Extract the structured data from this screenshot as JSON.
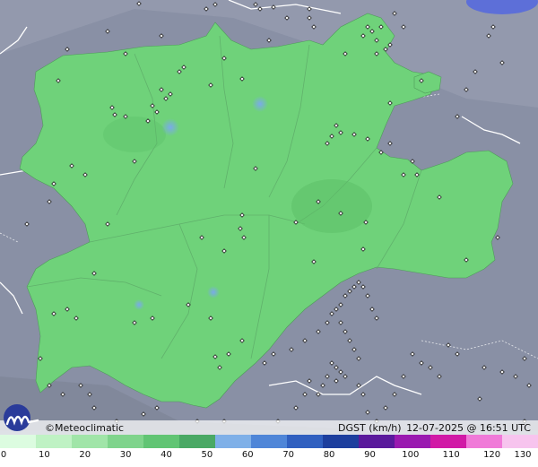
{
  "footer": {
    "brand": "Meteoclimatic",
    "copyright_symbol": "©",
    "variable": "DGST (km/h)",
    "timestamp": "12-07-2025 @ 16:51 UTC"
  },
  "legend": {
    "unit": "km/h",
    "ticks": [
      "0",
      "10",
      "20",
      "30",
      "40",
      "50",
      "60",
      "70",
      "80",
      "90",
      "100",
      "110",
      "120",
      "130"
    ],
    "colors": [
      "#dcfce0",
      "#bff2c4",
      "#a0e5a8",
      "#7fd48c",
      "#61c574",
      "#4aa965",
      "#7fb0e8",
      "#4f86d8",
      "#3060c0",
      "#1d3f9e",
      "#5a1a9c",
      "#9a1ab0",
      "#d11aa6",
      "#f07ad8",
      "#f7c4ee"
    ]
  },
  "map": {
    "region_fill": "#6fd27a",
    "background_fill": "#8990a5",
    "station_marker": "diamond"
  }
}
